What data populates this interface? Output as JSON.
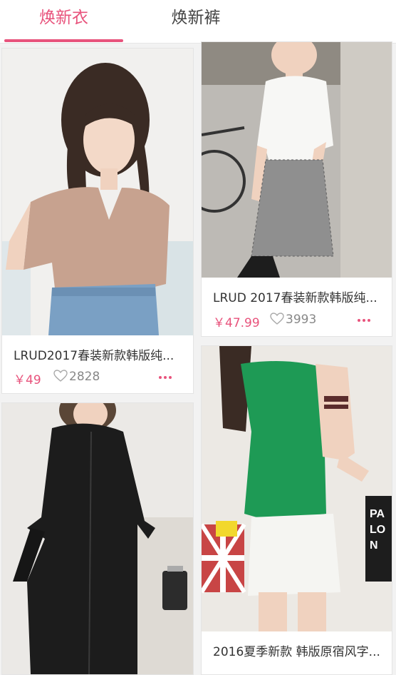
{
  "tabs": [
    {
      "label": "焕新衣",
      "active": true
    },
    {
      "label": "焕新裤",
      "active": false
    }
  ],
  "colors": {
    "accent": "#e8537c",
    "muted": "#888888"
  },
  "products": [
    {
      "title": "LRUD2017春装新款韩版纯...",
      "price": "￥49",
      "likes": "2828",
      "image": "woman in beige v-neck tee and jeans"
    },
    {
      "title": "LRUD 2017春装新款韩版纯...",
      "price": "￥47.99",
      "likes": "3993",
      "image": "woman in white tee and plaid skirt"
    },
    {
      "title": "2016夏季新款 韩版原宿风字...",
      "image": "woman in green sleeveless top and white shorts"
    },
    {
      "image": "woman in black long shirt dress"
    }
  ]
}
